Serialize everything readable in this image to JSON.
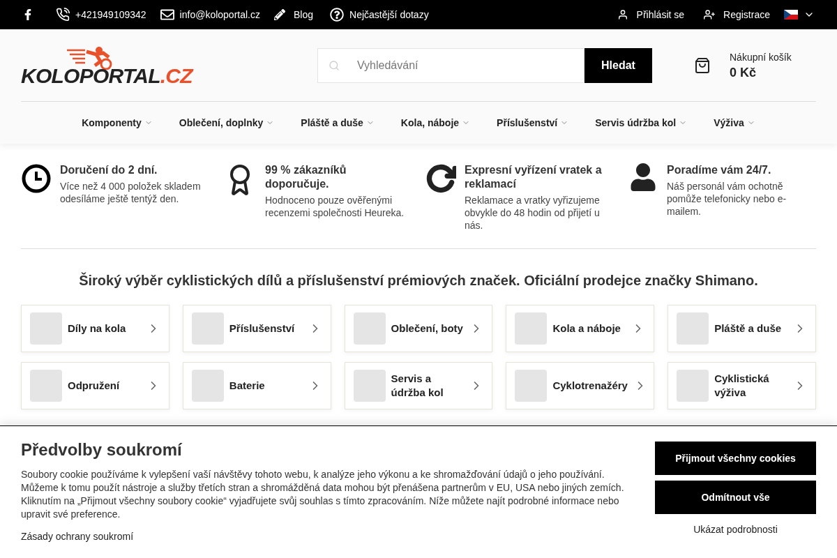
{
  "topbar": {
    "phone": "+421949109342",
    "email": "info@koloportal.cz",
    "blog": "Blog",
    "faq": "Nejčastější dotazy",
    "login": "Přihlásit se",
    "register": "Registrace"
  },
  "header": {
    "logo_main": "KOLOPORTAL",
    "logo_suffix": ".CZ",
    "search": {
      "placeholder": "Vyhledávání",
      "button": "Hledat"
    },
    "cart": {
      "label": "Nákupní košík",
      "total": "0 Kč"
    }
  },
  "nav": [
    "Komponenty",
    "Oblečení, doplnky",
    "Pláště a duše",
    "Kola, náboje",
    "Příslušenství",
    "Servis údržba kol",
    "Výživa"
  ],
  "features": [
    {
      "kind": "clock",
      "title": "Doručení do 2 dní.",
      "text": "Více než 4 000 položek skladem odesíláme ještě tentýž den."
    },
    {
      "kind": "award",
      "title": "99 % zákazníků doporučuje.",
      "text": "Hodnoceno pouze ověřenými recenzemi společnosti Heureka."
    },
    {
      "kind": "refresh",
      "title": "Expresní vyřízení vratek a reklamací",
      "text": "Reklamace a vratky vyřizujeme obvykle do 48 hodin od přijetí u nás."
    },
    {
      "kind": "user",
      "title": "Poradíme vám 24/7.",
      "text": "Náš personál vám ochotně pomůže telefonicky nebo e-mailem."
    }
  ],
  "headline": "Široký výběr cyklistických dílů a příslušenství prémiových značek. Oficiální prodejce značky Shimano.",
  "categories": [
    "Díly na kola",
    "Příslušenství",
    "Oblečení, boty",
    "Kola a náboje",
    "Pláště a duše",
    "Odpružení",
    "Baterie",
    "Servis a údržba kol",
    "Cyklotrenažéry",
    "Cyklistická výživa"
  ],
  "cookie_banner": {
    "title": "Předvolby soukromí",
    "text": "Soubory cookie používáme k vylepšení vaší návštěvy tohoto webu, k analýze jeho výkonu a ke shromažďování údajů o jeho používání. Můžeme k tomu použít nástroje a služby třetích stran a shromážděná data mohou být přenášena partnerům v EU, USA nebo jiných zemích. Kliknutím na „Přijmout všechny soubory cookie“ vyjadřujete svůj souhlas s tímto zpracováním. Níže můžete najít podrobné informace nebo upravit své preference.",
    "privacy_link": "Zásady ochrany soukromí",
    "accept": "Přijmout všechny cookies",
    "reject": "Odmítnout vše",
    "details": "Ukázat podrobnosti"
  }
}
